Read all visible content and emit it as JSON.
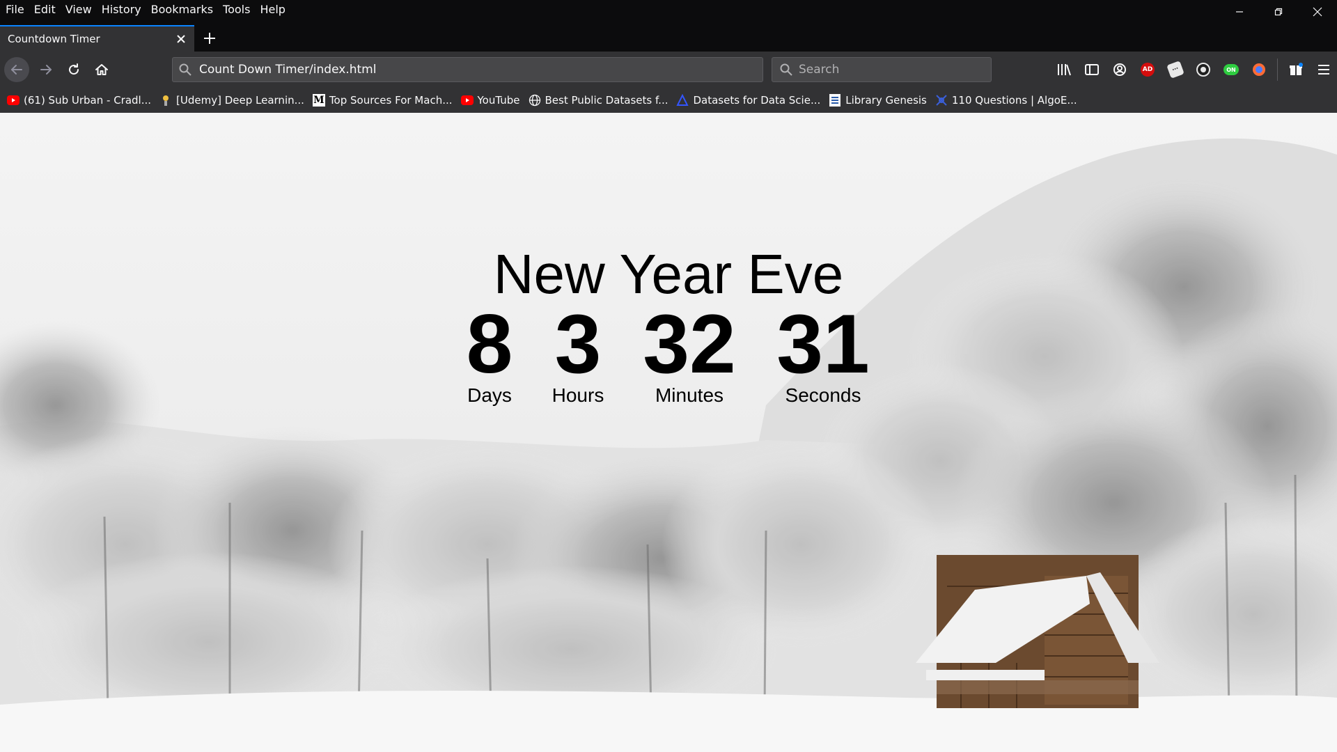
{
  "menubar": {
    "items": [
      "File",
      "Edit",
      "View",
      "History",
      "Bookmarks",
      "Tools",
      "Help"
    ]
  },
  "tab": {
    "title": "Countdown Timer"
  },
  "urlbar": {
    "url": "Count Down Timer/index.html"
  },
  "searchbar": {
    "placeholder": "Search"
  },
  "toolbar": {
    "icons": [
      "library-icon",
      "sidebar-icon",
      "account-icon",
      "adblock-icon",
      "extension-icon",
      "extension-icon-2",
      "extension-icon-3",
      "extension-icon-4",
      "whats-new-icon",
      "menu-icon"
    ]
  },
  "bookmarks": [
    {
      "label": "(61) Sub Urban - Cradl...",
      "icon": "youtube-icon"
    },
    {
      "label": "[Udemy] Deep Learnin...",
      "icon": "udemy-icon"
    },
    {
      "label": "Top Sources For Mach...",
      "icon": "medium-icon"
    },
    {
      "label": "YouTube",
      "icon": "youtube-icon"
    },
    {
      "label": "Best Public Datasets f...",
      "icon": "globe-icon"
    },
    {
      "label": "Datasets for Data Scie...",
      "icon": "triangle-icon"
    },
    {
      "label": "Library Genesis",
      "icon": "libgen-icon"
    },
    {
      "label": "110 Questions | AlgoE...",
      "icon": "algoexpert-icon"
    }
  ],
  "countdown": {
    "title": "New Year Eve",
    "days": {
      "value": "8",
      "label": "Days"
    },
    "hours": {
      "value": "3",
      "label": "Hours"
    },
    "minutes": {
      "value": "32",
      "label": "Minutes"
    },
    "seconds": {
      "value": "31",
      "label": "Seconds"
    }
  },
  "colors": {
    "chrome_dark": "#0c0c0d",
    "toolbar": "#323234",
    "accent": "#0a84ff",
    "page_bg": "#f3f3f3"
  }
}
